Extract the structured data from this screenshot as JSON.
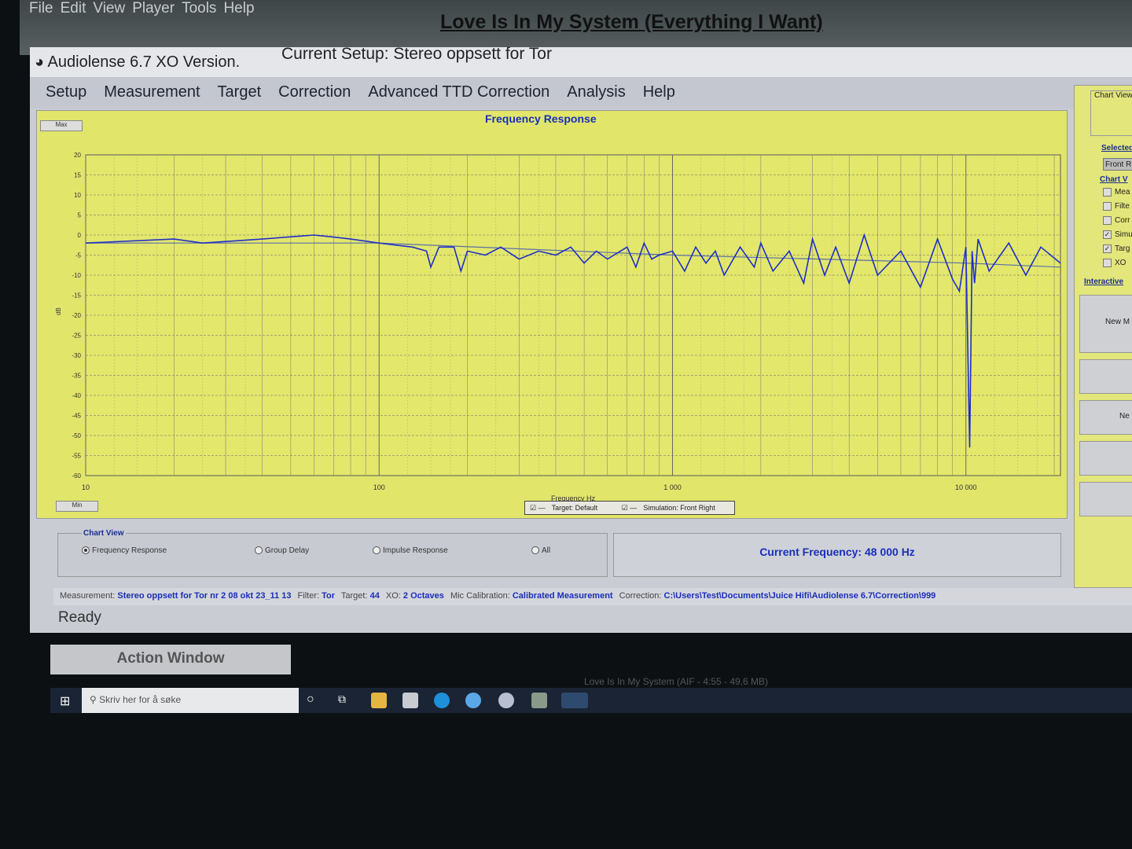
{
  "player": {
    "menu": [
      "File",
      "Edit",
      "View",
      "Player",
      "Tools",
      "Help"
    ],
    "song_title": "Love Is In My System (Everything I Want)",
    "footer": "Love Is In My System (AIF - 4:55 - 49,6 MB)"
  },
  "app": {
    "title": "Audiolense 6.7 XO Version.",
    "setup": "Current Setup: Stereo oppsett for Tor",
    "menu": [
      "Setup",
      "Measurement",
      "Target",
      "Correction",
      "Advanced TTD Correction",
      "Analysis",
      "Help"
    ]
  },
  "chart_buttons": {
    "max": "Max",
    "min": "Min"
  },
  "legend": {
    "target": "Target: Default",
    "simulation": "Simulation: Front Right"
  },
  "side": {
    "chart_view": "Chart View",
    "selected": "Selected",
    "selected_value": "Front R",
    "chart_v": "Chart V",
    "checks": [
      {
        "label": "Mea",
        "checked": false
      },
      {
        "label": "Filte",
        "checked": false
      },
      {
        "label": "Corr",
        "checked": false
      },
      {
        "label": "Simu",
        "checked": true
      },
      {
        "label": "Targ",
        "checked": true
      },
      {
        "label": "XO",
        "checked": false
      }
    ],
    "interactive": "Interactive",
    "buttons": [
      "New M",
      "",
      "Ne"
    ]
  },
  "chart_view": {
    "title": "Chart View",
    "options": [
      {
        "label": "Frequency Response",
        "selected": true
      },
      {
        "label": "Group Delay",
        "selected": false
      },
      {
        "label": "Impulse Response",
        "selected": false
      },
      {
        "label": "All",
        "selected": false
      }
    ]
  },
  "current_frequency": "Current Frequency: 48 000 Hz",
  "status": {
    "measurement_label": "Measurement:",
    "measurement": "Stereo oppsett for Tor nr 2 08 okt 23_11 13",
    "filter_label": "Filter:",
    "filter": "Tor",
    "target_label": "Target:",
    "target": "44",
    "xo_label": "XO:",
    "xo": "2 Octaves",
    "mic_label": "Mic Calibration:",
    "mic": "Calibrated Measurement",
    "correction_label": "Correction:",
    "correction": "C:\\Users\\Test\\Documents\\Juice Hifi\\Audiolense 6.7\\Correction\\999"
  },
  "ready": "Ready",
  "action_window": "Action Window",
  "taskbar": {
    "search_placeholder": "Skriv her for å søke"
  },
  "chart_data": {
    "type": "line",
    "title": "Frequency Response",
    "xlabel": "Frequency Hz",
    "ylabel": "dB",
    "xscale": "log",
    "xlim": [
      10,
      21000
    ],
    "ylim": [
      -60,
      20
    ],
    "xticks": [
      {
        "v": 10,
        "label": "10"
      },
      {
        "v": 100,
        "label": "100"
      },
      {
        "v": 1000,
        "label": "1 000"
      },
      {
        "v": 10000,
        "label": "10 000"
      }
    ],
    "yticks": [
      20,
      15,
      10,
      5,
      0,
      -5,
      -10,
      -15,
      -20,
      -25,
      -30,
      -35,
      -40,
      -45,
      -50,
      -55,
      -60
    ],
    "series": [
      {
        "name": "Target: Default",
        "color": "#5a6fa8",
        "x": [
          10,
          100,
          1000,
          10000,
          21000
        ],
        "y": [
          -2,
          -2,
          -5,
          -7,
          -8
        ]
      },
      {
        "name": "Simulation: Front Right",
        "color": "#1f2fc8",
        "x": [
          10,
          20,
          25,
          40,
          60,
          70,
          80,
          100,
          130,
          145,
          150,
          160,
          180,
          190,
          200,
          230,
          260,
          300,
          350,
          400,
          450,
          500,
          550,
          600,
          700,
          750,
          800,
          850,
          900,
          1000,
          1100,
          1200,
          1300,
          1400,
          1500,
          1700,
          1900,
          2000,
          2200,
          2500,
          2800,
          3000,
          3300,
          3600,
          4000,
          4500,
          5000,
          6000,
          7000,
          8000,
          9000,
          9500,
          10000,
          10300,
          10500,
          10700,
          11000,
          12000,
          14000,
          16000,
          18000,
          21000
        ],
        "y": [
          -2,
          -1,
          -2,
          -1,
          0,
          -0.5,
          -1,
          -2,
          -3,
          -4,
          -8,
          -3,
          -3,
          -9,
          -4,
          -5,
          -3,
          -6,
          -4,
          -5,
          -3,
          -7,
          -4,
          -6,
          -3,
          -8,
          -2,
          -6,
          -5,
          -4,
          -9,
          -3,
          -7,
          -4,
          -10,
          -3,
          -8,
          -2,
          -9,
          -4,
          -12,
          -1,
          -10,
          -3,
          -12,
          0,
          -10,
          -4,
          -13,
          -1,
          -11,
          -14,
          -3,
          -53,
          -4,
          -12,
          -1,
          -9,
          -2,
          -10,
          -3,
          -7
        ]
      }
    ]
  }
}
